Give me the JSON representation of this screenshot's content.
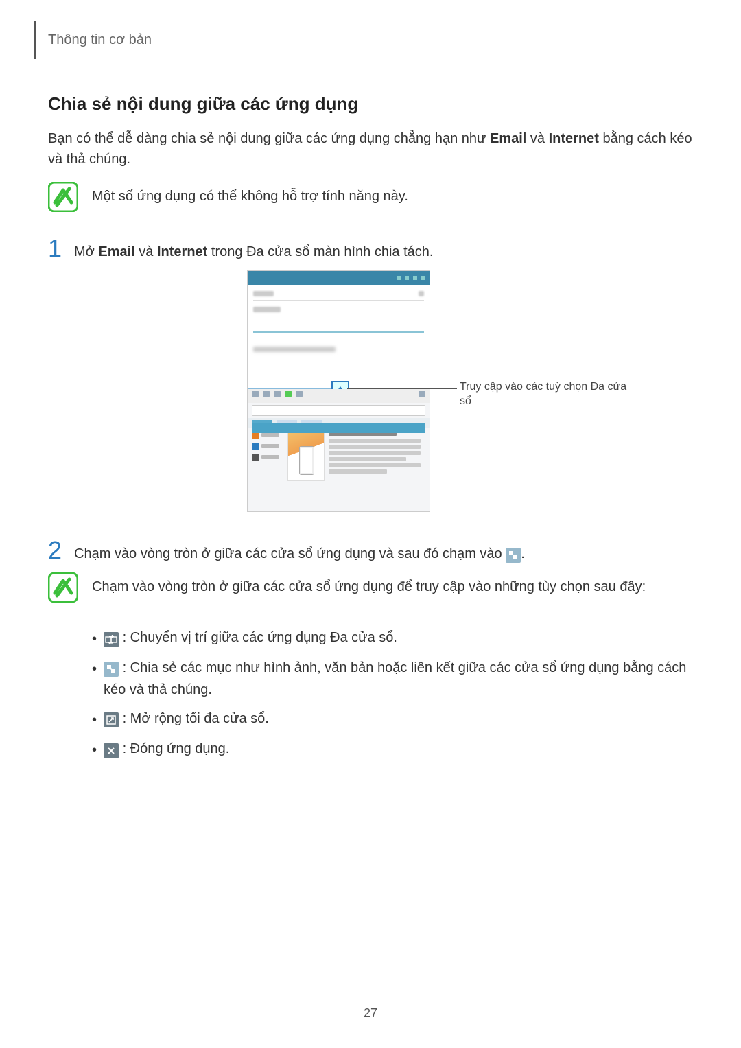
{
  "header": {
    "breadcrumb": "Thông tin cơ bản"
  },
  "section": {
    "title": "Chia sẻ nội dung giữa các ứng dụng",
    "intro_pre": "Bạn có thể dễ dàng chia sẻ nội dung giữa các ứng dụng chẳng hạn như ",
    "intro_bold1": "Email",
    "intro_mid": " và ",
    "intro_bold2": "Internet",
    "intro_post": " bằng cách kéo và thả chúng."
  },
  "note1": {
    "text": "Một số ứng dụng có thể không hỗ trợ tính năng này."
  },
  "step1": {
    "num": "1",
    "pre": "Mở ",
    "bold1": "Email",
    "mid": " và ",
    "bold2": "Internet",
    "post": " trong Đa cửa sổ màn hình chia tách."
  },
  "figure": {
    "callout": "Truy cập vào các tuỳ chọn Đa cửa sổ"
  },
  "step2": {
    "num": "2",
    "pre": "Chạm vào vòng tròn ở giữa các cửa sổ ứng dụng và sau đó chạm vào ",
    "post": "."
  },
  "note2": {
    "text": "Chạm vào vòng tròn ở giữa các cửa sổ ứng dụng để truy cập vào những tùy chọn sau đây:"
  },
  "bullets": {
    "b1": " : Chuyển vị trí giữa các ứng dụng Đa cửa sổ.",
    "b2": " : Chia sẻ các mục như hình ảnh, văn bản hoặc liên kết giữa các cửa sổ ứng dụng bằng cách kéo và thả chúng.",
    "b3": " : Mở rộng tối đa cửa sổ.",
    "b4": " : Đóng ứng dụng."
  },
  "page_number": "27"
}
